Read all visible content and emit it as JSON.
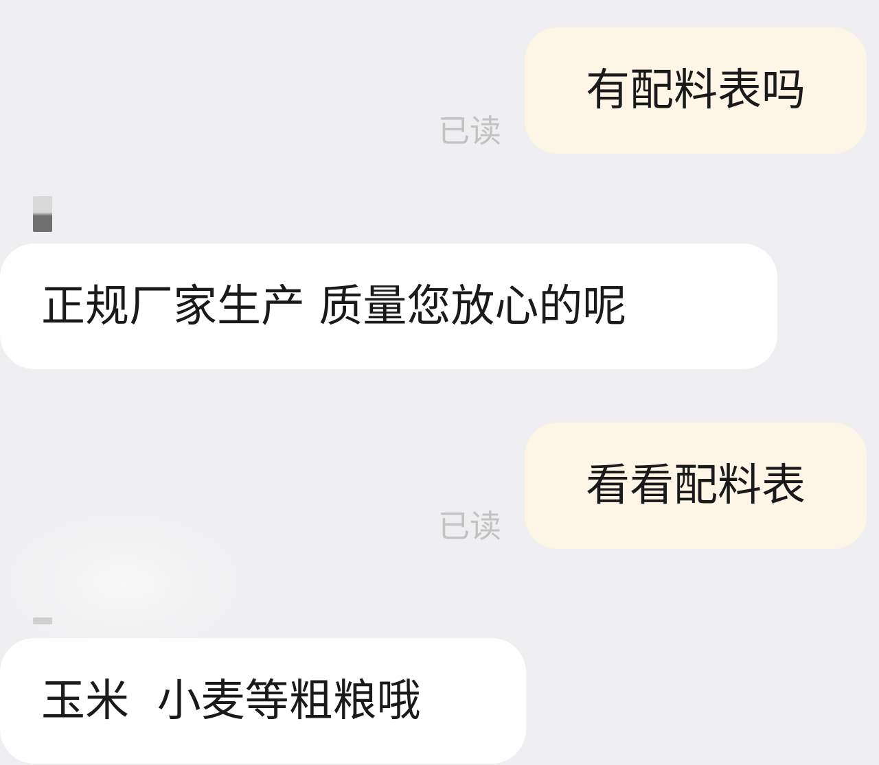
{
  "messages": [
    {
      "id": "m1",
      "direction": "outgoing",
      "text": "有配料表吗",
      "status": "已读"
    },
    {
      "id": "m2",
      "direction": "incoming",
      "text": "正规厂家生产 质量您放心的呢"
    },
    {
      "id": "m3",
      "direction": "outgoing",
      "text": "看看配料表",
      "status": "已读"
    },
    {
      "id": "m4",
      "direction": "incoming",
      "text": "玉米  小麦等粗粮哦"
    }
  ],
  "colors": {
    "background": "#efeff1",
    "outgoing_bubble": "#fdf6e7",
    "incoming_bubble": "#ffffff",
    "read_status": "#c2c2c2",
    "text": "#1a1a1a"
  }
}
